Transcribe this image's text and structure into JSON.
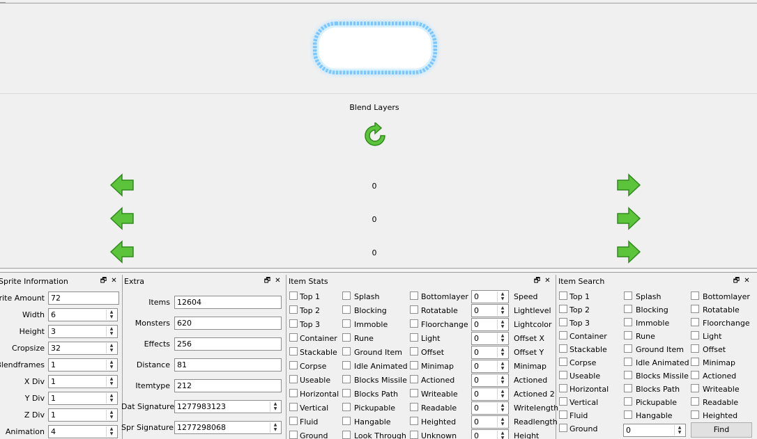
{
  "preview": {
    "blend_label": "Blend Layers",
    "counters": [
      "0",
      "0",
      "0"
    ],
    "icons": {
      "refresh": "refresh-icon",
      "left": "arrow-left-icon",
      "right": "arrow-right-icon"
    }
  },
  "sprite_info": {
    "title": "Sprite Information",
    "fields": [
      {
        "label": "Sprite Amount",
        "value": "72",
        "spinner": false
      },
      {
        "label": "Width",
        "value": "6",
        "spinner": true
      },
      {
        "label": "Height",
        "value": "3",
        "spinner": true
      },
      {
        "label": "Cropsize",
        "value": "32",
        "spinner": true
      },
      {
        "label": "Blendframes",
        "value": "1",
        "spinner": true
      },
      {
        "label": "X Div",
        "value": "1",
        "spinner": true
      },
      {
        "label": "Y Div",
        "value": "1",
        "spinner": true
      },
      {
        "label": "Z Div",
        "value": "1",
        "spinner": true
      },
      {
        "label": "Animation",
        "value": "4",
        "spinner": true
      }
    ]
  },
  "extra": {
    "title": "Extra",
    "fields": [
      {
        "label": "Items",
        "value": "12604",
        "spinner": false
      },
      {
        "label": "Monsters",
        "value": "620",
        "spinner": false
      },
      {
        "label": "Effects",
        "value": "256",
        "spinner": false
      },
      {
        "label": "Distance",
        "value": "81",
        "spinner": false
      },
      {
        "label": "Itemtype",
        "value": "212",
        "spinner": false
      },
      {
        "label": "Dat Signature",
        "value": "1277983123",
        "spinner": true
      },
      {
        "label": "Spr Signature",
        "value": "1277298068",
        "spinner": true
      }
    ]
  },
  "item_stats": {
    "title": "Item Stats",
    "col1": [
      "Top 1",
      "Top 2",
      "Top 3",
      "Container",
      "Stackable",
      "Corpse",
      "Useable",
      "Horizontal",
      "Vertical",
      "Fluid",
      "Ground"
    ],
    "col2": [
      "Splash",
      "Blocking",
      "Immoble",
      "Rune",
      "Ground Item",
      "Idle Animated",
      "Blocks Missile",
      "Blocks Path",
      "Pickupable",
      "Hangable",
      "Look Through"
    ],
    "col3": [
      "Bottomlayer",
      "Rotatable",
      "Floorchange",
      "Light",
      "Offset",
      "Minimap",
      "Actioned",
      "Writeable",
      "Readable",
      "Heighted",
      "Unknown"
    ],
    "numeric": [
      {
        "label": "Speed",
        "value": "0"
      },
      {
        "label": "Lightlevel",
        "value": "0"
      },
      {
        "label": "Lightcolor",
        "value": "0"
      },
      {
        "label": "Offset X",
        "value": "0"
      },
      {
        "label": "Offset Y",
        "value": "0"
      },
      {
        "label": "Minimap",
        "value": "0"
      },
      {
        "label": "Actioned",
        "value": "0"
      },
      {
        "label": "Actioned 2",
        "value": "0"
      },
      {
        "label": "Writelength",
        "value": "0"
      },
      {
        "label": "Readlength",
        "value": "0"
      },
      {
        "label": "Height",
        "value": "0"
      }
    ]
  },
  "item_search": {
    "title": "Item Search",
    "col1": [
      "Top 1",
      "Top 2",
      "Top 3",
      "Container",
      "Stackable",
      "Corpse",
      "Useable",
      "Horizontal",
      "Vertical",
      "Fluid",
      "Ground"
    ],
    "col2": [
      "Splash",
      "Blocking",
      "Immoble",
      "Rune",
      "Ground Item",
      "Idle Animated",
      "Blocks Missile",
      "Blocks Path",
      "Pickupable",
      "Hangable"
    ],
    "col3": [
      "Bottomlayer",
      "Rotatable",
      "Floorchange",
      "Light",
      "Offset",
      "Minimap",
      "Actioned",
      "Writeable",
      "Readable",
      "Heighted"
    ],
    "search_value": "0",
    "find_label": "Find"
  },
  "panel_controls": {
    "float": "🗗",
    "close": "✕"
  },
  "colors": {
    "arrow_green": "#5cc43a",
    "glow_blue": "#8fd0ff",
    "border": "#a0a0a0"
  }
}
